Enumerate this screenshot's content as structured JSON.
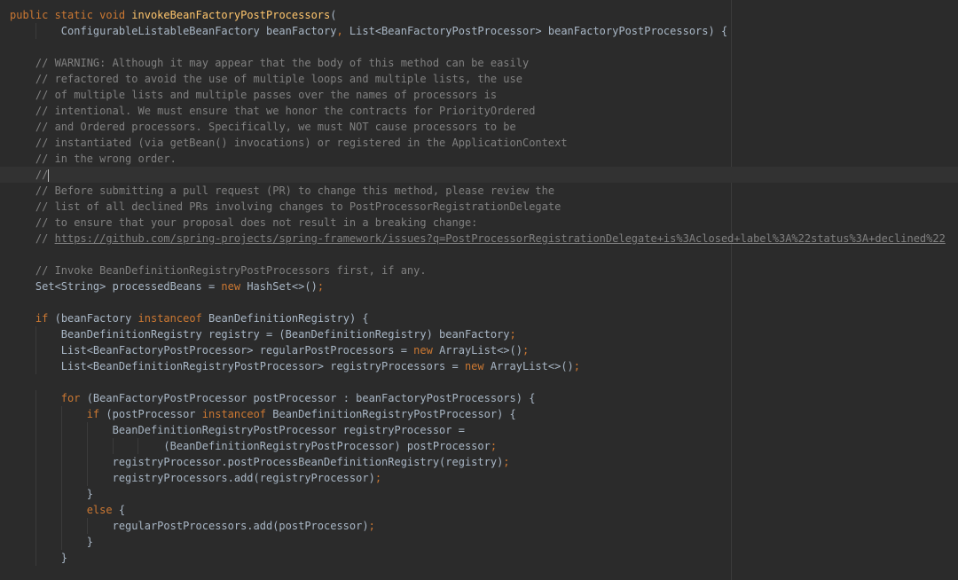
{
  "editor": {
    "lines": [
      {
        "indent": 0,
        "tokens": [
          {
            "t": "kw",
            "v": "public static void "
          },
          {
            "t": "fn",
            "v": "invokeBeanFactoryPostProcessors"
          },
          {
            "t": "pl",
            "v": "("
          }
        ]
      },
      {
        "indent": 8,
        "tokens": [
          {
            "t": "pl",
            "v": "ConfigurableListableBeanFactory beanFactory"
          },
          {
            "t": "kw",
            "v": ", "
          },
          {
            "t": "pl",
            "v": "List<BeanFactoryPostProcessor> beanFactoryPostProcessors) {"
          }
        ]
      },
      {
        "indent": 0,
        "tokens": []
      },
      {
        "indent": 4,
        "tokens": [
          {
            "t": "cm",
            "v": "// WARNING: Although it may appear that the body of this method can be easily"
          }
        ]
      },
      {
        "indent": 4,
        "tokens": [
          {
            "t": "cm",
            "v": "// refactored to avoid the use of multiple loops and multiple lists, the use"
          }
        ]
      },
      {
        "indent": 4,
        "tokens": [
          {
            "t": "cm",
            "v": "// of multiple lists and multiple passes over the names of processors is"
          }
        ]
      },
      {
        "indent": 4,
        "tokens": [
          {
            "t": "cm",
            "v": "// intentional. We must ensure that we honor the contracts for PriorityOrdered"
          }
        ]
      },
      {
        "indent": 4,
        "tokens": [
          {
            "t": "cm",
            "v": "// and Ordered processors. Specifically, we must NOT cause processors to be"
          }
        ]
      },
      {
        "indent": 4,
        "tokens": [
          {
            "t": "cm",
            "v": "// instantiated (via getBean() invocations) or registered in the ApplicationContext"
          }
        ]
      },
      {
        "indent": 4,
        "tokens": [
          {
            "t": "cm",
            "v": "// in the wrong order."
          }
        ]
      },
      {
        "indent": 4,
        "current": true,
        "tokens": [
          {
            "t": "cm",
            "v": "//"
          },
          {
            "t": "caret",
            "v": ""
          }
        ]
      },
      {
        "indent": 4,
        "tokens": [
          {
            "t": "cm",
            "v": "// Before submitting a pull request (PR) to change this method, please review the"
          }
        ]
      },
      {
        "indent": 4,
        "tokens": [
          {
            "t": "cm",
            "v": "// list of all declined PRs involving changes to PostProcessorRegistrationDelegate"
          }
        ]
      },
      {
        "indent": 4,
        "tokens": [
          {
            "t": "cm",
            "v": "// to ensure that your proposal does not result in a breaking change:"
          }
        ]
      },
      {
        "indent": 4,
        "tokens": [
          {
            "t": "cm",
            "v": "// "
          },
          {
            "t": "link",
            "v": "https://github.com/spring-projects/spring-framework/issues?q=PostProcessorRegistrationDelegate+is%3Aclosed+label%3A%22status%3A+declined%22"
          }
        ]
      },
      {
        "indent": 0,
        "tokens": []
      },
      {
        "indent": 4,
        "tokens": [
          {
            "t": "cm",
            "v": "// Invoke BeanDefinitionRegistryPostProcessors first, if any."
          }
        ]
      },
      {
        "indent": 4,
        "tokens": [
          {
            "t": "pl",
            "v": "Set<String> processedBeans = "
          },
          {
            "t": "kw",
            "v": "new "
          },
          {
            "t": "pl",
            "v": "HashSet<>()"
          },
          {
            "t": "kw",
            "v": ";"
          }
        ]
      },
      {
        "indent": 0,
        "tokens": []
      },
      {
        "indent": 4,
        "tokens": [
          {
            "t": "kw",
            "v": "if "
          },
          {
            "t": "pl",
            "v": "(beanFactory "
          },
          {
            "t": "kw",
            "v": "instanceof "
          },
          {
            "t": "pl",
            "v": "BeanDefinitionRegistry) {"
          }
        ]
      },
      {
        "indent": 8,
        "tokens": [
          {
            "t": "pl",
            "v": "BeanDefinitionRegistry registry = (BeanDefinitionRegistry) beanFactory"
          },
          {
            "t": "kw",
            "v": ";"
          }
        ]
      },
      {
        "indent": 8,
        "tokens": [
          {
            "t": "pl",
            "v": "List<BeanFactoryPostProcessor> regularPostProcessors = "
          },
          {
            "t": "kw",
            "v": "new "
          },
          {
            "t": "pl",
            "v": "ArrayList<>()"
          },
          {
            "t": "kw",
            "v": ";"
          }
        ]
      },
      {
        "indent": 8,
        "tokens": [
          {
            "t": "pl",
            "v": "List<BeanDefinitionRegistryPostProcessor> registryProcessors = "
          },
          {
            "t": "kw",
            "v": "new "
          },
          {
            "t": "pl",
            "v": "ArrayList<>()"
          },
          {
            "t": "kw",
            "v": ";"
          }
        ]
      },
      {
        "indent": 0,
        "tokens": []
      },
      {
        "indent": 8,
        "tokens": [
          {
            "t": "kw",
            "v": "for "
          },
          {
            "t": "pl",
            "v": "(BeanFactoryPostProcessor postProcessor : beanFactoryPostProcessors) {"
          }
        ]
      },
      {
        "indent": 12,
        "tokens": [
          {
            "t": "kw",
            "v": "if "
          },
          {
            "t": "pl",
            "v": "(postProcessor "
          },
          {
            "t": "kw",
            "v": "instanceof "
          },
          {
            "t": "pl",
            "v": "BeanDefinitionRegistryPostProcessor) {"
          }
        ]
      },
      {
        "indent": 16,
        "tokens": [
          {
            "t": "pl",
            "v": "BeanDefinitionRegistryPostProcessor registryProcessor ="
          }
        ]
      },
      {
        "indent": 24,
        "tokens": [
          {
            "t": "pl",
            "v": "(BeanDefinitionRegistryPostProcessor) postProcessor"
          },
          {
            "t": "kw",
            "v": ";"
          }
        ]
      },
      {
        "indent": 16,
        "tokens": [
          {
            "t": "pl",
            "v": "registryProcessor.postProcessBeanDefinitionRegistry(registry)"
          },
          {
            "t": "kw",
            "v": ";"
          }
        ]
      },
      {
        "indent": 16,
        "tokens": [
          {
            "t": "pl",
            "v": "registryProcessors.add(registryProcessor)"
          },
          {
            "t": "kw",
            "v": ";"
          }
        ]
      },
      {
        "indent": 12,
        "tokens": [
          {
            "t": "pl",
            "v": "}"
          }
        ]
      },
      {
        "indent": 12,
        "tokens": [
          {
            "t": "kw",
            "v": "else "
          },
          {
            "t": "pl",
            "v": "{"
          }
        ]
      },
      {
        "indent": 16,
        "tokens": [
          {
            "t": "pl",
            "v": "regularPostProcessors.add(postProcessor)"
          },
          {
            "t": "kw",
            "v": ";"
          }
        ]
      },
      {
        "indent": 12,
        "tokens": [
          {
            "t": "pl",
            "v": "}"
          }
        ]
      },
      {
        "indent": 8,
        "tokens": [
          {
            "t": "pl",
            "v": "}"
          }
        ]
      }
    ]
  },
  "colors": {
    "background": "#2b2b2b",
    "plain": "#a9b7c6",
    "keyword": "#cc7832",
    "method": "#ffc66d",
    "comment": "#808080"
  }
}
